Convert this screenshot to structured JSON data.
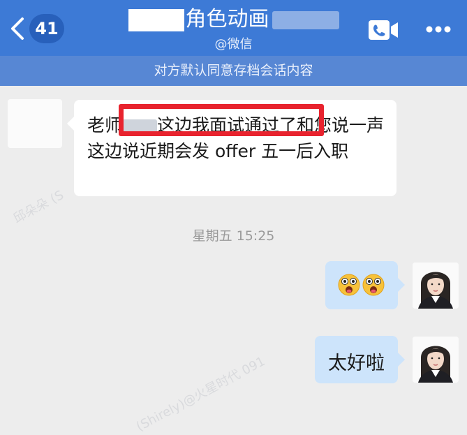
{
  "header": {
    "unread_count": "41",
    "title_visible": "角色动画",
    "subtitle": "@微信"
  },
  "consent_notice": "对方默认同意存档会话内容",
  "messages": [
    {
      "direction": "incoming",
      "text_before": "老师",
      "text_highlight": "这边我面试通过了",
      "text_after": "和您说一声 这边说近期会发 offer 五一后入职"
    },
    {
      "type": "timestamp",
      "text": "星期五 15:25"
    },
    {
      "direction": "outgoing",
      "content": "emoji",
      "emoji_names": [
        "wow-face-emoji",
        "wow-face-emoji"
      ]
    },
    {
      "direction": "outgoing",
      "text": "太好啦"
    }
  ],
  "watermark": {
    "left": "邱朵朵 (S",
    "bottom": "(Shirely)@火星时代 091"
  },
  "colors": {
    "header_bg": "#3d7ad6",
    "consent_bg": "#5787d4",
    "outgoing_bubble": "#cde4fb",
    "highlight": "#e8232e"
  }
}
